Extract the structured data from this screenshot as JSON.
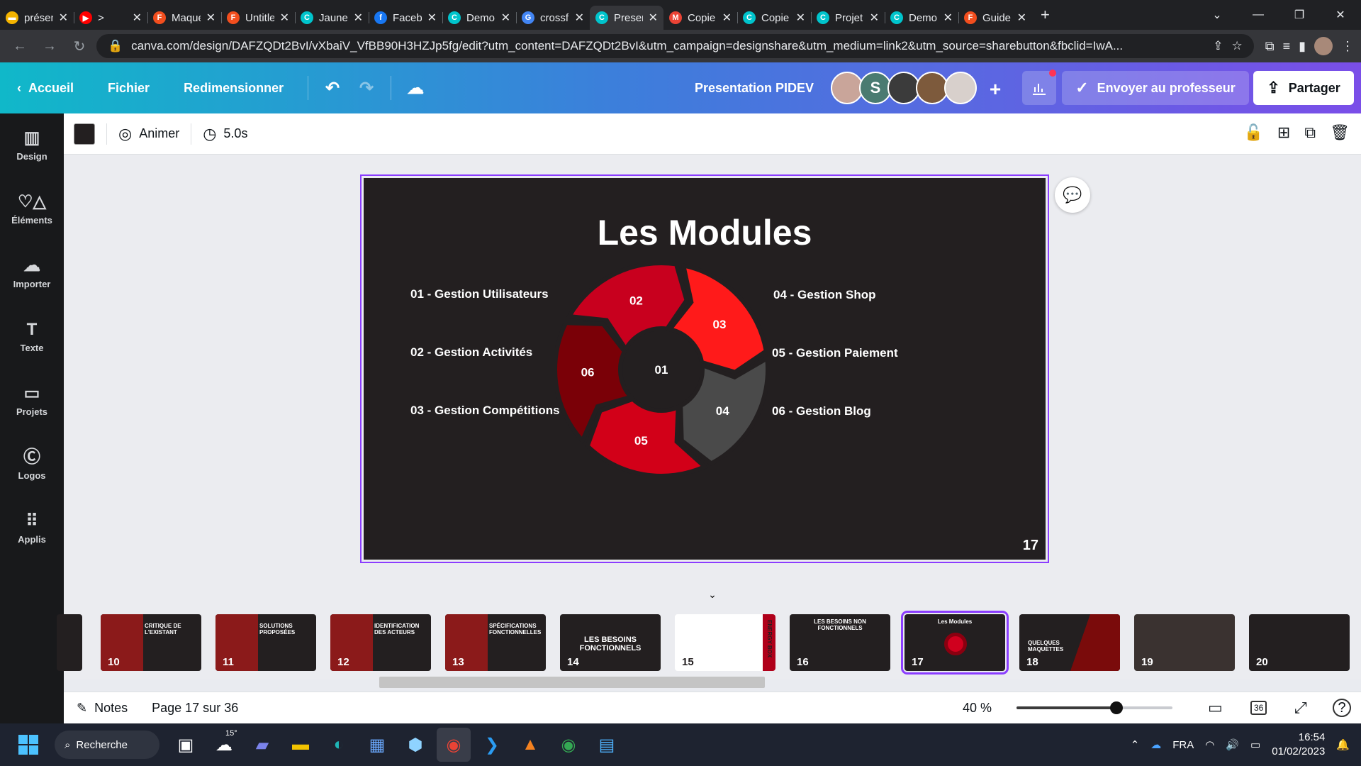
{
  "tabs": [
    {
      "title": "présentation",
      "color": "#f4b400",
      "glyph": "▬",
      "active": false
    },
    {
      "title": ">",
      "color": "#ff0000",
      "glyph": "▶",
      "active": false,
      "muted_icon": "🔇"
    },
    {
      "title": "Maquette",
      "color": "#f24e1e",
      "glyph": "F",
      "active": false
    },
    {
      "title": "Untitled",
      "color": "#f24e1e",
      "glyph": "F",
      "active": false
    },
    {
      "title": "Jaune",
      "color": "#00c4cc",
      "glyph": "C",
      "active": false
    },
    {
      "title": "Facebook",
      "color": "#1877f2",
      "glyph": "f",
      "active": false
    },
    {
      "title": "Demo",
      "color": "#00c4cc",
      "glyph": "C",
      "active": false
    },
    {
      "title": "crossfit",
      "color": "#4285f4",
      "glyph": "G",
      "active": false
    },
    {
      "title": "Presentation",
      "color": "#00c4cc",
      "glyph": "C",
      "active": true
    },
    {
      "title": "Copie",
      "color": "#ea4335",
      "glyph": "M",
      "active": false
    },
    {
      "title": "Copie",
      "color": "#00c4cc",
      "glyph": "C",
      "active": false
    },
    {
      "title": "Projet",
      "color": "#00c4cc",
      "glyph": "C",
      "active": false
    },
    {
      "title": "Demo",
      "color": "#00c4cc",
      "glyph": "C",
      "active": false
    },
    {
      "title": "Guide",
      "color": "#f24e1e",
      "glyph": "F",
      "active": false
    }
  ],
  "url": "canva.com/design/DAFZQDt2BvI/vXbaiV_VfBB90H3HZJp5fg/edit?utm_content=DAFZQDt2BvI&utm_campaign=designshare&utm_medium=link2&utm_source=sharebutton&fbclid=IwA...",
  "header": {
    "home": "Accueil",
    "file": "Fichier",
    "resize": "Redimensionner",
    "title": "Presentation PIDEV",
    "avatar_letter": "S",
    "send": "Envoyer au professeur",
    "share": "Partager"
  },
  "sidebar": [
    {
      "label": "Design",
      "icon": "▥"
    },
    {
      "label": "Éléments",
      "icon": "♡△"
    },
    {
      "label": "Importer",
      "icon": "☁"
    },
    {
      "label": "Texte",
      "icon": "T"
    },
    {
      "label": "Projets",
      "icon": "▭"
    },
    {
      "label": "Logos",
      "icon": "Ⓒ"
    },
    {
      "label": "Applis",
      "icon": "⠿"
    }
  ],
  "toolbar": {
    "animate": "Animer",
    "duration": "5.0s"
  },
  "slide": {
    "title": "Les Modules",
    "page_number": "17",
    "left_modules": [
      "01 - Gestion Utilisateurs",
      "02 - Gestion Activités",
      "03 - Gestion Compétitions"
    ],
    "right_modules": [
      "04 - Gestion Shop",
      "05 - Gestion Paiement",
      "06 - Gestion Blog"
    ],
    "center_label": "01",
    "segments": [
      {
        "label": "02",
        "color": "#c8001e"
      },
      {
        "label": "03",
        "color": "#ff1a1a"
      },
      {
        "label": "04",
        "color": "#4a4a4a"
      },
      {
        "label": "05",
        "color": "#d20018"
      },
      {
        "label": "06",
        "color": "#7a0007"
      }
    ]
  },
  "thumbnails": [
    {
      "num": "10",
      "text": "CRITIQUE DE L'EXISTANT"
    },
    {
      "num": "11",
      "text": "SOLUTIONS PROPOSÉES"
    },
    {
      "num": "12",
      "text": "IDENTIFICATION DES ACTEURS"
    },
    {
      "num": "13",
      "text": "SPÉCIFICATIONS FONCTIONNELLES"
    },
    {
      "num": "14",
      "text": "LES BESOINS FONCTIONNELS"
    },
    {
      "num": "15",
      "text": "ENERGY BOX"
    },
    {
      "num": "16",
      "text": "LES BESOINS NON FONCTIONNELS"
    },
    {
      "num": "17",
      "text": "Les Modules",
      "selected": true
    },
    {
      "num": "18",
      "text": "QUELQUES MAQUETTES"
    },
    {
      "num": "19",
      "text": ""
    },
    {
      "num": "20",
      "text": ""
    }
  ],
  "footer": {
    "notes": "Notes",
    "page": "Page 17 sur 36",
    "zoom": "40 %",
    "zoom_level": 0.4,
    "grid_count": "36"
  },
  "taskbar": {
    "search": "Recherche",
    "temp": "15°",
    "lang": "FRA",
    "time": "16:54",
    "date": "01/02/2023"
  }
}
